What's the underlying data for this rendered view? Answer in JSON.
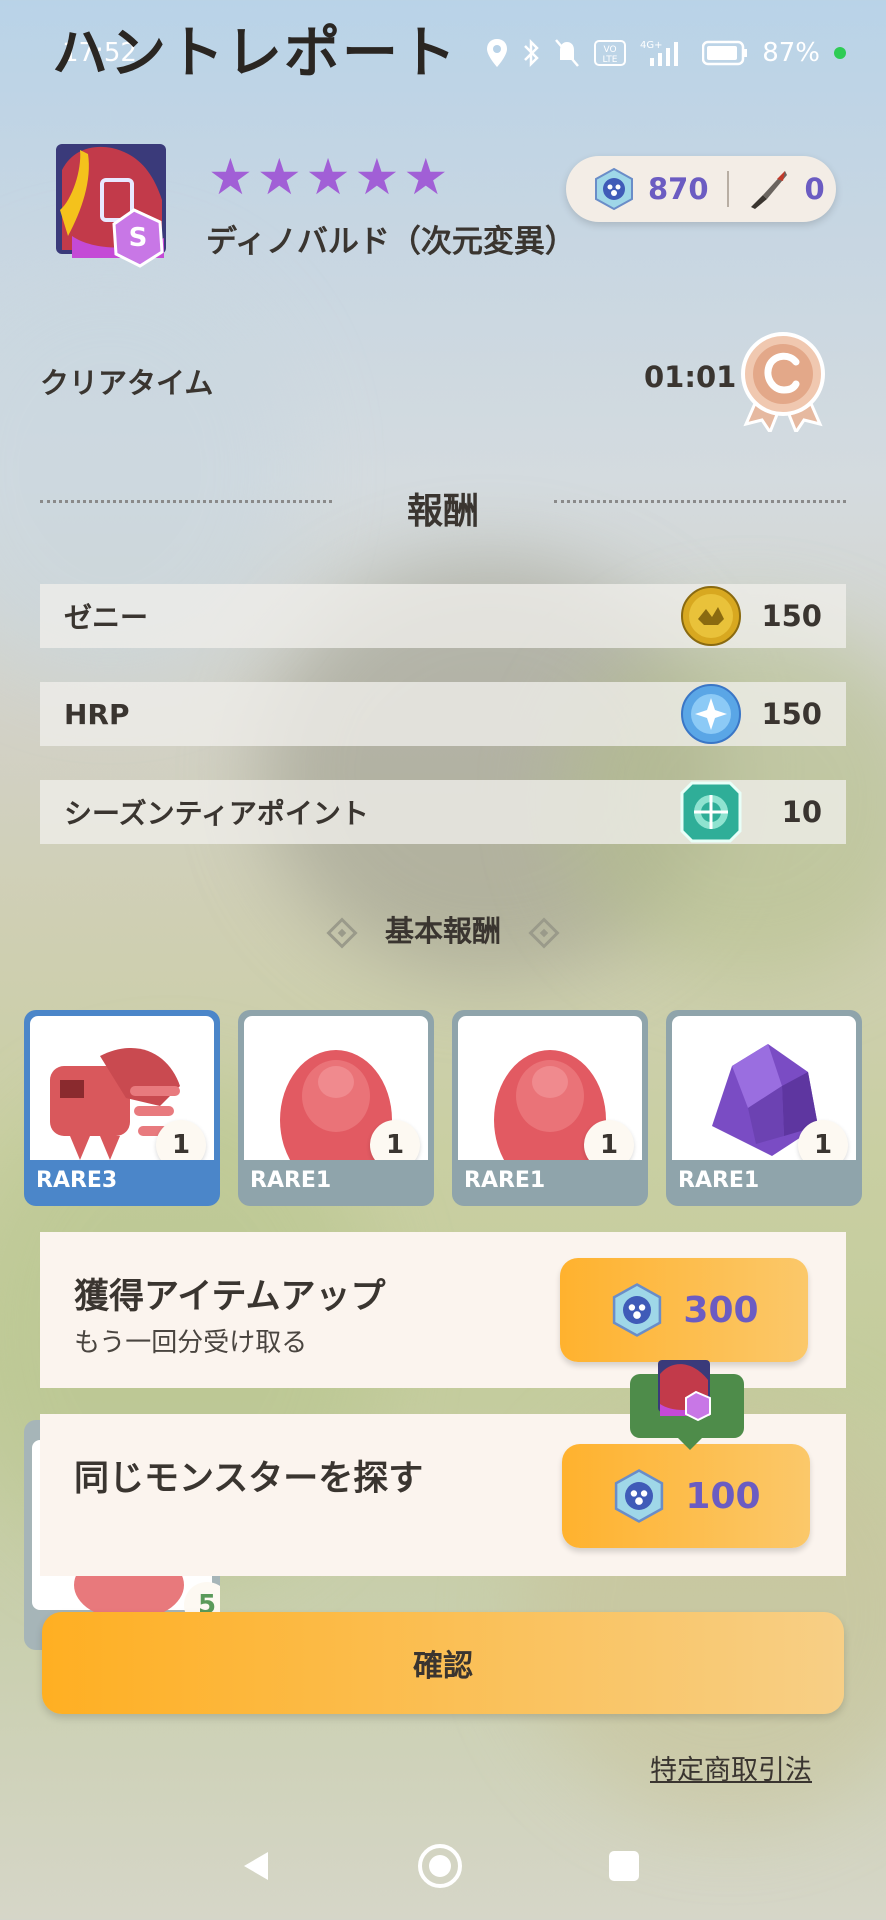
{
  "status_bar": {
    "time": "17:52",
    "battery": "87%",
    "network": "4G+"
  },
  "page_title": "ハントレポート",
  "monster": {
    "stars": 5,
    "name": "ディノバルド（次元変異）"
  },
  "currency": {
    "gems": "870",
    "tickets": "0"
  },
  "clear_time": {
    "label": "クリアタイム",
    "value": "01:01"
  },
  "rewards_section": {
    "title": "報酬",
    "rows": [
      {
        "name": "ゼニー",
        "value": "150"
      },
      {
        "name": "HRP",
        "value": "150"
      },
      {
        "name": "シーズンティアポイント",
        "value": "10"
      }
    ]
  },
  "basic_rewards": {
    "title": "基本報酬",
    "items": [
      {
        "rarity": "RARE3",
        "count": "1"
      },
      {
        "rarity": "RARE1",
        "count": "1"
      },
      {
        "rarity": "RARE1",
        "count": "1"
      },
      {
        "rarity": "RARE1",
        "count": "1"
      }
    ]
  },
  "item_up": {
    "title": "獲得アイテムアップ",
    "subtitle": "もう一回分受け取る",
    "cost": "300"
  },
  "find_monster": {
    "title": "同じモンスターを探す",
    "cost": "100"
  },
  "behind_card": {
    "count": "5"
  },
  "confirm_label": "確認",
  "legal_link": "特定商取引法",
  "colors": {
    "accent_orange": "#ffb22e",
    "gem_purple": "#6b5cc2",
    "selected_blue": "#4b86c9"
  }
}
